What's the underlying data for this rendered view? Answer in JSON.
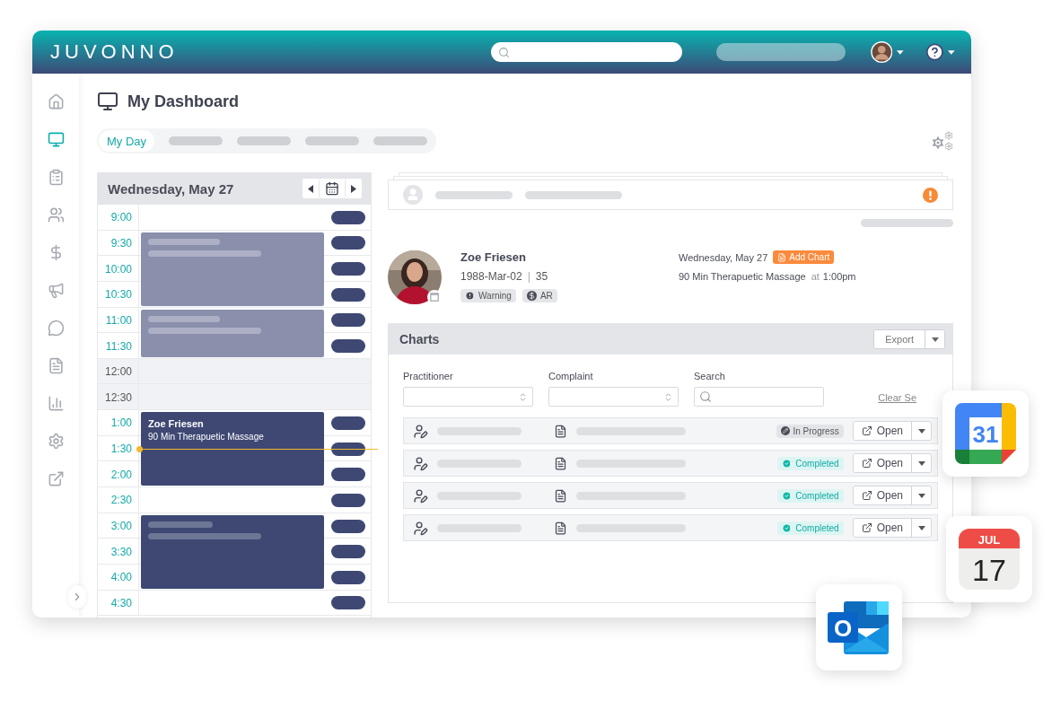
{
  "header": {
    "logo": "JUVONNO"
  },
  "sidebar": {
    "items": [
      {
        "kind": "home",
        "selected": false
      },
      {
        "kind": "dashboard",
        "selected": true
      },
      {
        "kind": "clipboard",
        "selected": false
      },
      {
        "kind": "clients",
        "selected": false
      },
      {
        "kind": "billing",
        "selected": false
      },
      {
        "kind": "marketing",
        "selected": false
      },
      {
        "kind": "messages",
        "selected": false
      },
      {
        "kind": "documents",
        "selected": false
      },
      {
        "kind": "reports",
        "selected": false
      },
      {
        "kind": "settings",
        "selected": false
      },
      {
        "kind": "external",
        "selected": false
      }
    ]
  },
  "page": {
    "title": "My Dashboard"
  },
  "tabs": [
    {
      "label": "My Day",
      "selected": true
    },
    {
      "selected": false
    },
    {
      "selected": false
    },
    {
      "selected": false
    },
    {
      "selected": false
    }
  ],
  "calendar": {
    "date": "Wednesday, May 27",
    "slots": [
      {
        "time": "9:00",
        "kind": "open",
        "continues": false,
        "now": false
      },
      {
        "time": "9:30",
        "kind": "open",
        "continues": false,
        "now": false,
        "event": {
          "kind": "placeholder",
          "past": true
        }
      },
      {
        "time": "10:00",
        "kind": "open",
        "continues": true,
        "now": false
      },
      {
        "time": "10:30",
        "kind": "open",
        "continues": true,
        "now": false
      },
      {
        "time": "11:00",
        "kind": "open",
        "continues": false,
        "now": false,
        "event": {
          "kind": "placeholder",
          "past": true
        }
      },
      {
        "time": "11:30",
        "kind": "open",
        "continues": true,
        "now": false
      },
      {
        "time": "12:00",
        "kind": "break",
        "continues": false,
        "now": false
      },
      {
        "time": "12:30",
        "kind": "break",
        "continues": false,
        "now": false
      },
      {
        "time": "1:00",
        "kind": "open",
        "continues": false,
        "now": false,
        "event": {
          "kind": "named",
          "past": false,
          "name": "Zoe Friesen",
          "service": "90 Min Therapuetic Massage"
        }
      },
      {
        "time": "1:30",
        "kind": "open",
        "continues": true,
        "now": true
      },
      {
        "time": "2:00",
        "kind": "open",
        "continues": true,
        "now": false
      },
      {
        "time": "2:30",
        "kind": "open",
        "continues": false,
        "now": false
      },
      {
        "time": "3:00",
        "kind": "open",
        "continues": false,
        "now": false,
        "event": {
          "kind": "placeholder",
          "past": false
        }
      },
      {
        "time": "3:30",
        "kind": "open",
        "continues": true,
        "now": false
      },
      {
        "time": "4:00",
        "kind": "open",
        "continues": true,
        "now": false
      },
      {
        "time": "4:30",
        "kind": "open",
        "continues": false,
        "now": false
      }
    ]
  },
  "patient": {
    "name": "Zoe Friesen",
    "birth_date": "1988-Mar-02",
    "separator": "|",
    "age": "35",
    "tags": [
      {
        "kind": "warning",
        "label": "Warning"
      },
      {
        "kind": "money",
        "label": "AR"
      }
    ]
  },
  "appointment": {
    "date": "Wednesday, May 27",
    "action": "Add Chart",
    "service": "90 Min Therapuetic Massage",
    "connector": "at",
    "time": "1:00pm"
  },
  "charts": {
    "title": "Charts",
    "export": "Export",
    "filters": [
      {
        "kind": "select",
        "label": "Practitioner"
      },
      {
        "kind": "select",
        "label": "Complaint"
      },
      {
        "kind": "search",
        "label": "Search"
      }
    ],
    "clear": "Clear Se",
    "rows": [
      {
        "status": {
          "kind": "in_progress",
          "label": "In Progress"
        },
        "action": "Open"
      },
      {
        "status": {
          "kind": "completed",
          "label": "Completed"
        },
        "action": "Open"
      },
      {
        "status": {
          "kind": "completed",
          "label": "Completed"
        },
        "action": "Open"
      },
      {
        "status": {
          "kind": "completed",
          "label": "Completed"
        },
        "action": "Open"
      }
    ]
  },
  "floating_apps": [
    {
      "kind": "google_calendar",
      "day": "31"
    },
    {
      "kind": "apple_calendar",
      "month": "JUL",
      "day": "17"
    },
    {
      "kind": "outlook",
      "letter": "O"
    }
  ]
}
